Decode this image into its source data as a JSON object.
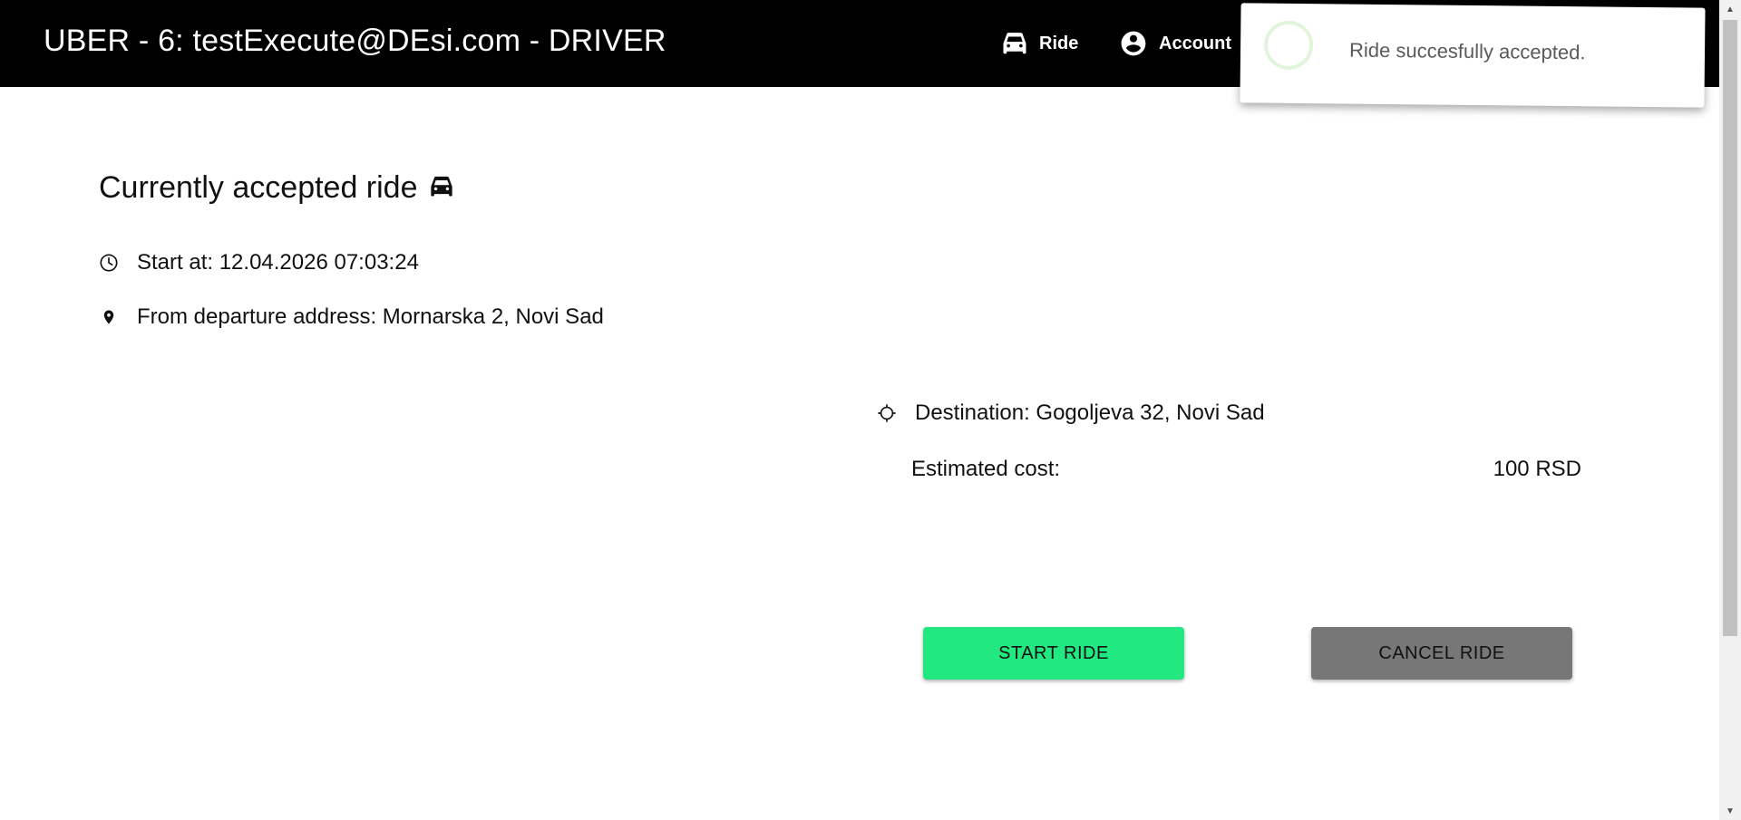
{
  "header": {
    "title": "UBER - 6: testExecute@DEsi.com - DRIVER",
    "nav": [
      {
        "label": "Ride",
        "icon": "car-icon"
      },
      {
        "label": "Account",
        "icon": "account-circle-icon"
      }
    ]
  },
  "toast": {
    "message": "Ride succesfully accepted.",
    "icon": "spinner-icon"
  },
  "ride": {
    "heading": "Currently accepted ride",
    "heading_icon": "car-icon",
    "start_at": "Start at: 12.04.2026 07:03:24",
    "start_icon": "clock-icon",
    "departure": "From departure address: Mornarska 2, Novi Sad",
    "departure_icon": "map-pin-icon",
    "destination": "Destination: Gogoljeva 32, Novi Sad",
    "destination_icon": "crosshair-icon",
    "cost_label": "Estimated cost:",
    "cost_value": "100 RSD"
  },
  "actions": {
    "start_label": "START RIDE",
    "cancel_label": "CANCEL RIDE"
  },
  "colors": {
    "header_bg": "#000000",
    "start_button": "#22e882",
    "cancel_button": "#777777",
    "toast_spinner": "#e1f5dc"
  }
}
